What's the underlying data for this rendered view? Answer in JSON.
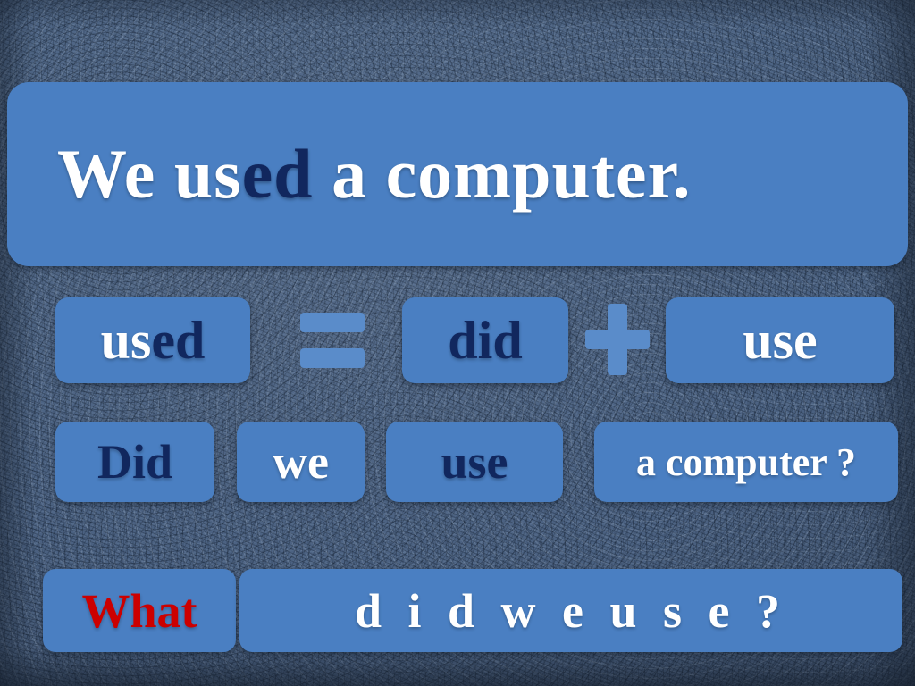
{
  "slide": {
    "background_color": "#4b6283",
    "card_color": "#4a7fc2",
    "operator_color": "#5a8cca",
    "white": "#ffffff",
    "navy": "#11275e",
    "red": "#cc0000"
  },
  "title": {
    "full": "We used a computer.",
    "segment_white_start": "We us",
    "segment_navy": "ed",
    "segment_white_end": " a computer."
  },
  "row_equation": {
    "used_white": "us",
    "used_navy": "ed",
    "operator_equals": "=",
    "did": "did",
    "operator_plus": "+",
    "use": "use"
  },
  "row_question": {
    "did": "Did",
    "we": "we",
    "use": "use",
    "object": "a computer ?"
  },
  "row_whquestion": {
    "what": "What",
    "rest": "d i d  w e  u s e ?"
  }
}
